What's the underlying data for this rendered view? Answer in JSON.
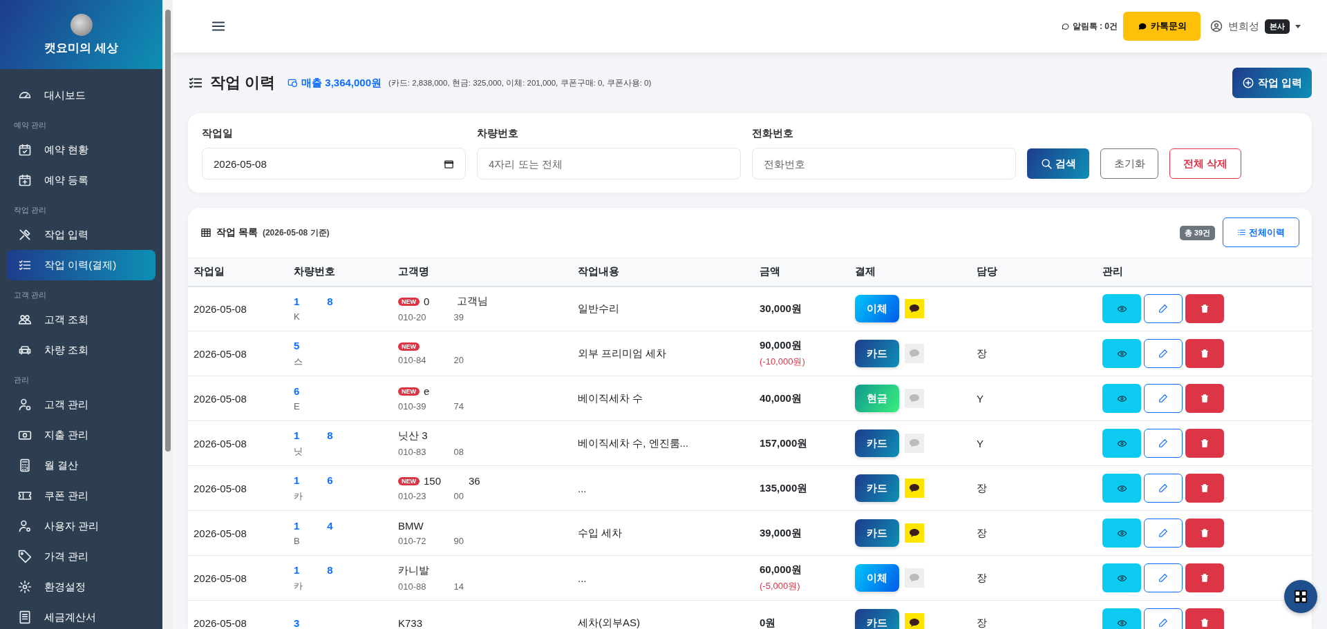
{
  "sidebar": {
    "brand": "캣요미의 세상",
    "sections": [
      {
        "items": [
          {
            "label": "대시보드",
            "selected": false
          }
        ]
      },
      {
        "heading": "예약 관리",
        "items": [
          {
            "label": "예약 현황",
            "selected": false
          },
          {
            "label": "예약 등록",
            "selected": false
          }
        ]
      },
      {
        "heading": "작업 관리",
        "items": [
          {
            "label": "작업 입력",
            "selected": false
          },
          {
            "label": "작업 이력(결제)",
            "selected": true
          }
        ]
      },
      {
        "heading": "고객 관리",
        "items": [
          {
            "label": "고객 조회",
            "selected": false
          },
          {
            "label": "차량 조회",
            "selected": false
          }
        ]
      },
      {
        "heading": "관리",
        "items": [
          {
            "label": "고객 관리",
            "selected": false
          },
          {
            "label": "지출 관리",
            "selected": false
          },
          {
            "label": "월 결산",
            "selected": false
          },
          {
            "label": "쿠폰 관리",
            "selected": false
          },
          {
            "label": "사용자 관리",
            "selected": false
          },
          {
            "label": "가격 관리",
            "selected": false
          },
          {
            "label": "환경설정",
            "selected": false
          },
          {
            "label": "세금계산서",
            "selected": false
          }
        ]
      }
    ]
  },
  "topbar": {
    "notice": "알림톡 : 0건",
    "kakao_button": "카톡문의",
    "user": "변희성",
    "user_badge": "본사"
  },
  "page": {
    "title": "작업 이력",
    "sales": "매출 3,364,000원",
    "sales_detail": "(카드: 2,838,000, 현금: 325,000, 이체: 201,000, 쿠폰구매: 0, 쿠폰사용: 0)",
    "add_button": "작업 입력"
  },
  "filter": {
    "fields": [
      {
        "label": "작업일",
        "value": "2026-05-08",
        "kind": "date"
      },
      {
        "label": "차량번호",
        "placeholder": "4자리 또는 전체",
        "kind": "text"
      },
      {
        "label": "전화번호",
        "placeholder": "전화번호",
        "kind": "text"
      }
    ],
    "search_button": "검색",
    "reset_button": "초기화",
    "delete_all_button": "전체 삭제"
  },
  "table": {
    "title": "작업 목록",
    "subtitle": "(2026-05-08 기준)",
    "count_badge": "총 39건",
    "history_button": "전체이력",
    "columns": [
      "작업일",
      "차량번호",
      "고객명",
      "작업내용",
      "금액",
      "결제",
      "담당",
      "관리"
    ],
    "rows": [
      {
        "date": "2026-05-08",
        "car": [
          "1",
          "8"
        ],
        "model": [
          "K"
        ],
        "badge": "NEW",
        "customer": [
          "0",
          "고객님"
        ],
        "phone": [
          "010-20",
          "39"
        ],
        "work": "일반수리",
        "amount": "30,000원",
        "payment": {
          "kind": "transfer",
          "label": "이체"
        },
        "talk_sent": true
      },
      {
        "date": "2026-05-08",
        "car": [
          "5"
        ],
        "model": [
          "스"
        ],
        "badge": "NEW",
        "phone": [
          "010-84",
          "20"
        ],
        "work": "외부 프리미엄 세차",
        "amount": "90,000원",
        "discount": "(-10,000원)",
        "payment": {
          "kind": "card",
          "label": "카드"
        },
        "talk_sent": false,
        "staff": [
          "장"
        ]
      },
      {
        "date": "2026-05-08",
        "car": [
          "6"
        ],
        "model": [
          "E"
        ],
        "badge": "NEW",
        "customer": [
          "e"
        ],
        "phone": [
          "010-39",
          "74"
        ],
        "work": "베이직세차 수",
        "amount": "40,000원",
        "payment": {
          "kind": "cash",
          "label": "현금"
        },
        "talk_sent": false,
        "staff": [
          "Y"
        ]
      },
      {
        "date": "2026-05-08",
        "car": [
          "1",
          "8"
        ],
        "model": [
          "닛"
        ],
        "customer": [
          "닛산 3"
        ],
        "phone": [
          "010-83",
          "08"
        ],
        "work": "베이직세차 수, 엔진룸...",
        "amount": "157,000원",
        "payment": {
          "kind": "card",
          "label": "카드"
        },
        "talk_sent": false,
        "staff": [
          "Y"
        ]
      },
      {
        "date": "2026-05-08",
        "car": [
          "1",
          "6"
        ],
        "model": [
          "카"
        ],
        "badge": "NEW",
        "customer": [
          "150",
          "36"
        ],
        "phone": [
          "010-23",
          "00"
        ],
        "work": "...",
        "amount": "135,000원",
        "payment": {
          "kind": "card",
          "label": "카드"
        },
        "talk_sent": true,
        "staff": [
          "장"
        ]
      },
      {
        "date": "2026-05-08",
        "car": [
          "1",
          "4"
        ],
        "model": [
          "B"
        ],
        "customer": [
          "BMW"
        ],
        "phone": [
          "010-72",
          "90"
        ],
        "work": "수입 세차",
        "amount": "39,000원",
        "payment": {
          "kind": "card",
          "label": "카드"
        },
        "talk_sent": true,
        "staff": [
          "장"
        ]
      },
      {
        "date": "2026-05-08",
        "car": [
          "1",
          "8"
        ],
        "model": [
          "카"
        ],
        "customer": [
          "카니발"
        ],
        "phone": [
          "010-88",
          "14"
        ],
        "work": "...",
        "amount": "60,000원",
        "discount": "(-5,000원)",
        "payment": {
          "kind": "transfer",
          "label": "이체"
        },
        "talk_sent": false,
        "staff": [
          "장"
        ]
      },
      {
        "date": "2026-05-08",
        "car": [
          "3"
        ],
        "customer": [
          "K733"
        ],
        "work": "세차(외부AS)",
        "amount": "0원",
        "payment": {
          "kind": "card",
          "label": "카드"
        },
        "talk_sent": true,
        "staff": [
          "장"
        ]
      }
    ]
  }
}
